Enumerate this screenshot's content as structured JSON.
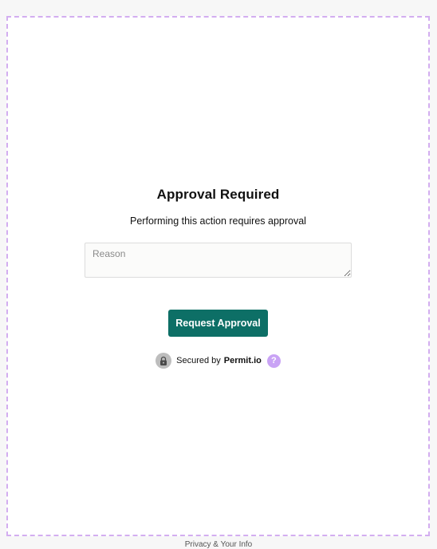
{
  "dialog": {
    "title": "Approval Required",
    "subtitle": "Performing this action requires approval",
    "reason_placeholder": "Reason",
    "reason_value": "",
    "submit_label": "Request Approval"
  },
  "secured": {
    "prefix": "Secured by",
    "brand": "Permit.io",
    "help_glyph": "?",
    "lock_icon": "lock-icon",
    "help_icon": "question-icon"
  },
  "footer": {
    "text": "Privacy & Your Info"
  },
  "colors": {
    "frame_border": "#d3aef0",
    "button_bg": "#0d6f66",
    "help_bg": "#c9a3f5",
    "lock_bg": "#bdbdbd"
  }
}
